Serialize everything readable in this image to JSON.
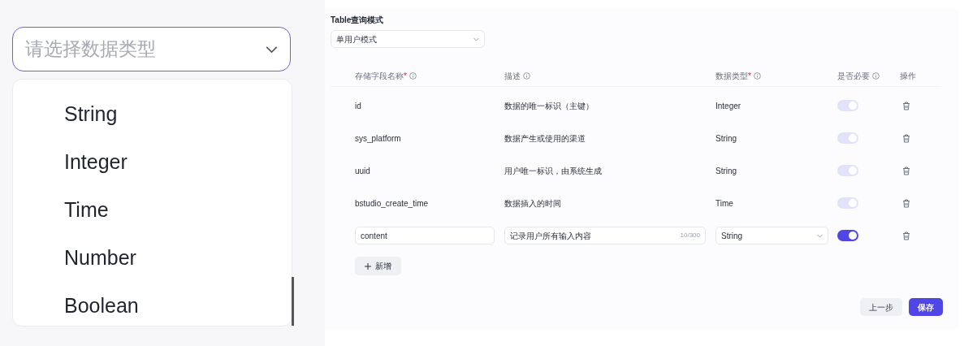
{
  "type_select": {
    "placeholder": "请选择数据类型",
    "expanded": true,
    "options": [
      {
        "label": "String",
        "selected": false
      },
      {
        "label": "Integer",
        "selected": false
      },
      {
        "label": "Time",
        "selected": false
      },
      {
        "label": "Number",
        "selected": false
      },
      {
        "label": "Boolean",
        "selected": false
      }
    ]
  },
  "form": {
    "mode_label": "Table查询模式",
    "mode_value": "单用户模式",
    "columns": [
      {
        "label": "存储字段名称",
        "required_mark": "*",
        "info": true
      },
      {
        "label": "描述",
        "info": true
      },
      {
        "label": "数据类型",
        "required_mark": "*",
        "info": true
      },
      {
        "label": "是否必要",
        "info": true
      },
      {
        "label": "操作",
        "info": false
      }
    ],
    "rows": [
      {
        "kind": "fixed",
        "name": "id",
        "description": "数据的唯一标识（主键）",
        "type": "Integer",
        "required": {
          "on": true,
          "disabled": true
        }
      },
      {
        "kind": "fixed",
        "name": "sys_platform",
        "description": "数据产生或使用的渠道",
        "type": "String",
        "required": {
          "on": true,
          "disabled": true
        }
      },
      {
        "kind": "fixed",
        "name": "uuid",
        "description": "用户唯一标识，由系统生成",
        "type": "String",
        "required": {
          "on": true,
          "disabled": true
        }
      },
      {
        "kind": "fixed",
        "name": "bstudio_create_time",
        "description": "数据插入的时间",
        "type": "Time",
        "required": {
          "on": true,
          "disabled": true
        }
      },
      {
        "kind": "edit",
        "name": "content",
        "description": "记录用户所有输入内容",
        "counter": "10/300",
        "type": "String",
        "required": {
          "on": true,
          "disabled": false
        }
      }
    ],
    "add_button": "新增",
    "back_button": "上一步",
    "save_button": "保存"
  }
}
